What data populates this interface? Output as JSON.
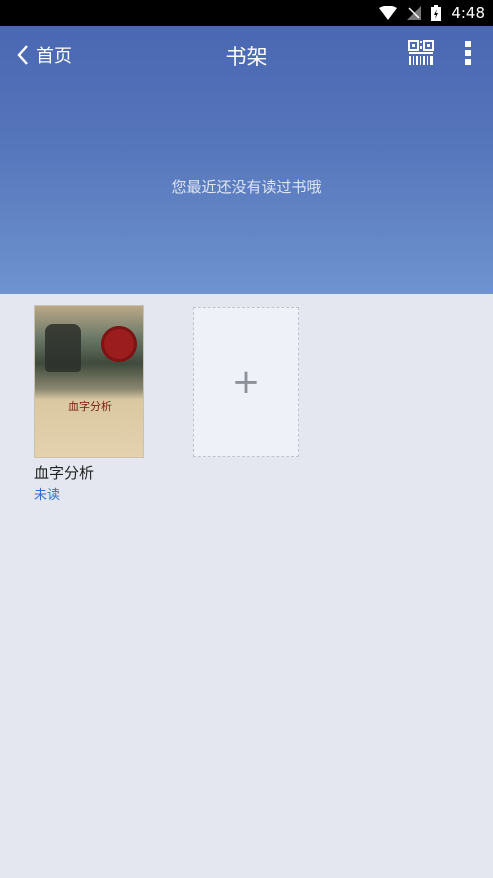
{
  "status_bar": {
    "time": "4:48"
  },
  "header": {
    "back_label": "首页",
    "title": "书架",
    "empty_message": "您最近还没有读过书哦"
  },
  "shelf": {
    "books": [
      {
        "cover_title": "血字分析",
        "name": "血字分析",
        "status": "未读"
      }
    ],
    "add_symbol": "+"
  }
}
